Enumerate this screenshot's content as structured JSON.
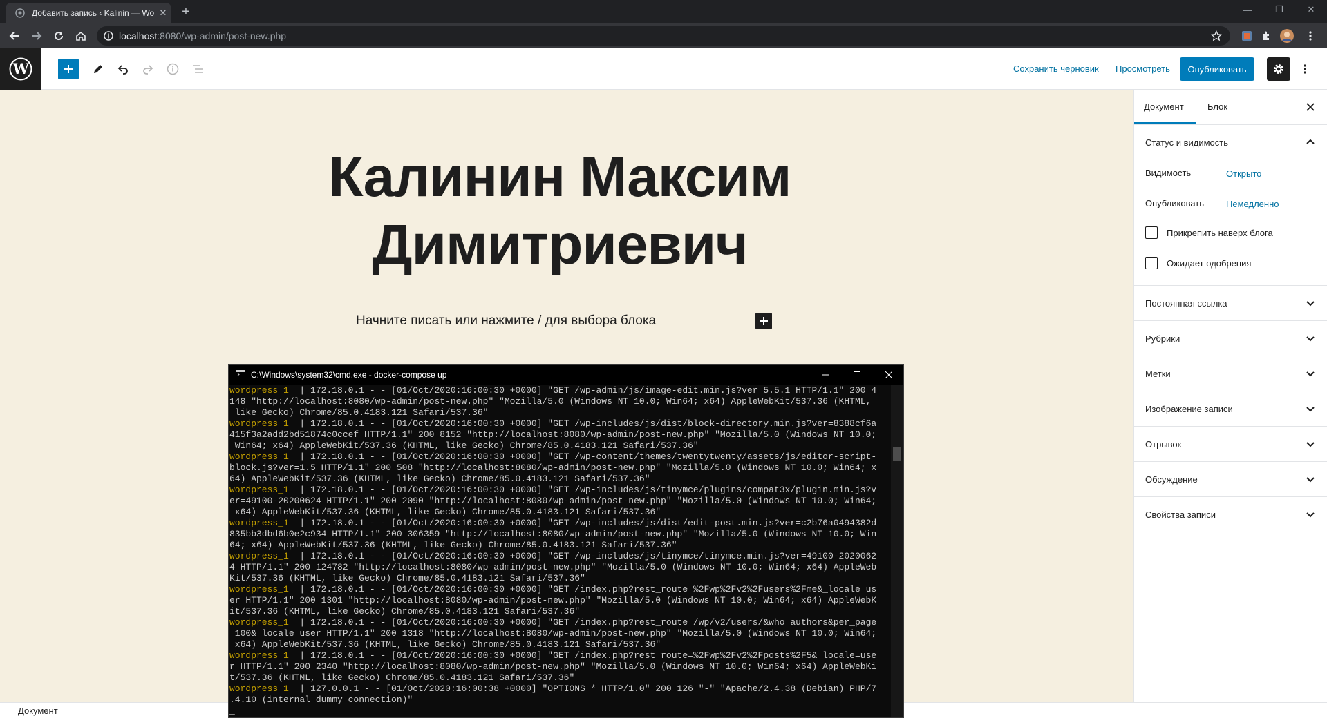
{
  "browser": {
    "tab_title": "Добавить запись ‹ Kalinin — Wo",
    "url_host": "localhost",
    "url_path": ":8080/wp-admin/post-new.php"
  },
  "toolbar": {
    "save_draft": "Сохранить черновик",
    "preview": "Просмотреть",
    "publish": "Опубликовать"
  },
  "editor": {
    "title_line1": "Калинин Максим",
    "title_line2": "Димитриевич",
    "block_placeholder": "Начните писать или нажмите / для выбора блока"
  },
  "sidebar": {
    "tab_document": "Документ",
    "tab_block": "Блок",
    "status_panel": {
      "title": "Статус и видимость",
      "visibility_label": "Видимость",
      "visibility_value": "Открыто",
      "published_label": "Опубликовать",
      "published_value": "Немедленно",
      "sticky_label": "Прикрепить наверх блога",
      "pending_label": "Ожидает одобрения"
    },
    "panels": [
      "Постоянная ссылка",
      "Рубрики",
      "Метки",
      "Изображение записи",
      "Отрывок",
      "Обсуждение",
      "Свойства записи"
    ]
  },
  "footer": {
    "breadcrumb": "Документ"
  },
  "cmd": {
    "title": "C:\\Windows\\system32\\cmd.exe - docker-compose  up",
    "lines": [
      {
        "svc": "wordpress_1",
        "text": "  | 172.18.0.1 - - [01/Oct/2020:16:00:30 +0000] \"GET /wp-admin/js/image-edit.min.js?ver=5.5.1 HTTP/1.1\" 200 4"
      },
      {
        "svc": "",
        "text": "148 \"http://localhost:8080/wp-admin/post-new.php\" \"Mozilla/5.0 (Windows NT 10.0; Win64; x64) AppleWebKit/537.36 (KHTML,"
      },
      {
        "svc": "",
        "text": " like Gecko) Chrome/85.0.4183.121 Safari/537.36\""
      },
      {
        "svc": "wordpress_1",
        "text": "  | 172.18.0.1 - - [01/Oct/2020:16:00:30 +0000] \"GET /wp-includes/js/dist/block-directory.min.js?ver=8388cf6a"
      },
      {
        "svc": "",
        "text": "415f3a2add2bd51874c0ccef HTTP/1.1\" 200 8152 \"http://localhost:8080/wp-admin/post-new.php\" \"Mozilla/5.0 (Windows NT 10.0;"
      },
      {
        "svc": "",
        "text": " Win64; x64) AppleWebKit/537.36 (KHTML, like Gecko) Chrome/85.0.4183.121 Safari/537.36\""
      },
      {
        "svc": "wordpress_1",
        "text": "  | 172.18.0.1 - - [01/Oct/2020:16:00:30 +0000] \"GET /wp-content/themes/twentytwenty/assets/js/editor-script-"
      },
      {
        "svc": "",
        "text": "block.js?ver=1.5 HTTP/1.1\" 200 508 \"http://localhost:8080/wp-admin/post-new.php\" \"Mozilla/5.0 (Windows NT 10.0; Win64; x"
      },
      {
        "svc": "",
        "text": "64) AppleWebKit/537.36 (KHTML, like Gecko) Chrome/85.0.4183.121 Safari/537.36\""
      },
      {
        "svc": "wordpress_1",
        "text": "  | 172.18.0.1 - - [01/Oct/2020:16:00:30 +0000] \"GET /wp-includes/js/tinymce/plugins/compat3x/plugin.min.js?v"
      },
      {
        "svc": "",
        "text": "er=49100-20200624 HTTP/1.1\" 200 2090 \"http://localhost:8080/wp-admin/post-new.php\" \"Mozilla/5.0 (Windows NT 10.0; Win64;"
      },
      {
        "svc": "",
        "text": " x64) AppleWebKit/537.36 (KHTML, like Gecko) Chrome/85.0.4183.121 Safari/537.36\""
      },
      {
        "svc": "wordpress_1",
        "text": "  | 172.18.0.1 - - [01/Oct/2020:16:00:30 +0000] \"GET /wp-includes/js/dist/edit-post.min.js?ver=c2b76a0494382d"
      },
      {
        "svc": "",
        "text": "835bb3dbd6b0e2c934 HTTP/1.1\" 200 306359 \"http://localhost:8080/wp-admin/post-new.php\" \"Mozilla/5.0 (Windows NT 10.0; Win"
      },
      {
        "svc": "",
        "text": "64; x64) AppleWebKit/537.36 (KHTML, like Gecko) Chrome/85.0.4183.121 Safari/537.36\""
      },
      {
        "svc": "wordpress_1",
        "text": "  | 172.18.0.1 - - [01/Oct/2020:16:00:30 +0000] \"GET /wp-includes/js/tinymce/tinymce.min.js?ver=49100-2020062"
      },
      {
        "svc": "",
        "text": "4 HTTP/1.1\" 200 124782 \"http://localhost:8080/wp-admin/post-new.php\" \"Mozilla/5.0 (Windows NT 10.0; Win64; x64) AppleWeb"
      },
      {
        "svc": "",
        "text": "Kit/537.36 (KHTML, like Gecko) Chrome/85.0.4183.121 Safari/537.36\""
      },
      {
        "svc": "wordpress_1",
        "text": "  | 172.18.0.1 - - [01/Oct/2020:16:00:30 +0000] \"GET /index.php?rest_route=%2Fwp%2Fv2%2Fusers%2Fme&_locale=us"
      },
      {
        "svc": "",
        "text": "er HTTP/1.1\" 200 1301 \"http://localhost:8080/wp-admin/post-new.php\" \"Mozilla/5.0 (Windows NT 10.0; Win64; x64) AppleWebK"
      },
      {
        "svc": "",
        "text": "it/537.36 (KHTML, like Gecko) Chrome/85.0.4183.121 Safari/537.36\""
      },
      {
        "svc": "wordpress_1",
        "text": "  | 172.18.0.1 - - [01/Oct/2020:16:00:30 +0000] \"GET /index.php?rest_route=/wp/v2/users/&who=authors&per_page"
      },
      {
        "svc": "",
        "text": "=100&_locale=user HTTP/1.1\" 200 1318 \"http://localhost:8080/wp-admin/post-new.php\" \"Mozilla/5.0 (Windows NT 10.0; Win64;"
      },
      {
        "svc": "",
        "text": " x64) AppleWebKit/537.36 (KHTML, like Gecko) Chrome/85.0.4183.121 Safari/537.36\""
      },
      {
        "svc": "wordpress_1",
        "text": "  | 172.18.0.1 - - [01/Oct/2020:16:00:30 +0000] \"GET /index.php?rest_route=%2Fwp%2Fv2%2Fposts%2F5&_locale=use"
      },
      {
        "svc": "",
        "text": "r HTTP/1.1\" 200 2340 \"http://localhost:8080/wp-admin/post-new.php\" \"Mozilla/5.0 (Windows NT 10.0; Win64; x64) AppleWebKi"
      },
      {
        "svc": "",
        "text": "t/537.36 (KHTML, like Gecko) Chrome/85.0.4183.121 Safari/537.36\""
      },
      {
        "svc": "wordpress_1",
        "text": "  | 127.0.0.1 - - [01/Oct/2020:16:00:38 +0000] \"OPTIONS * HTTP/1.0\" 200 126 \"-\" \"Apache/2.4.38 (Debian) PHP/7"
      },
      {
        "svc": "",
        "text": ".4.10 (internal dummy connection)\""
      },
      {
        "svc": "",
        "text": "_"
      }
    ]
  },
  "colors": {
    "wp_blue": "#007cba",
    "canvas_bg": "#f5efe0",
    "terminal_service": "#c4a000"
  }
}
